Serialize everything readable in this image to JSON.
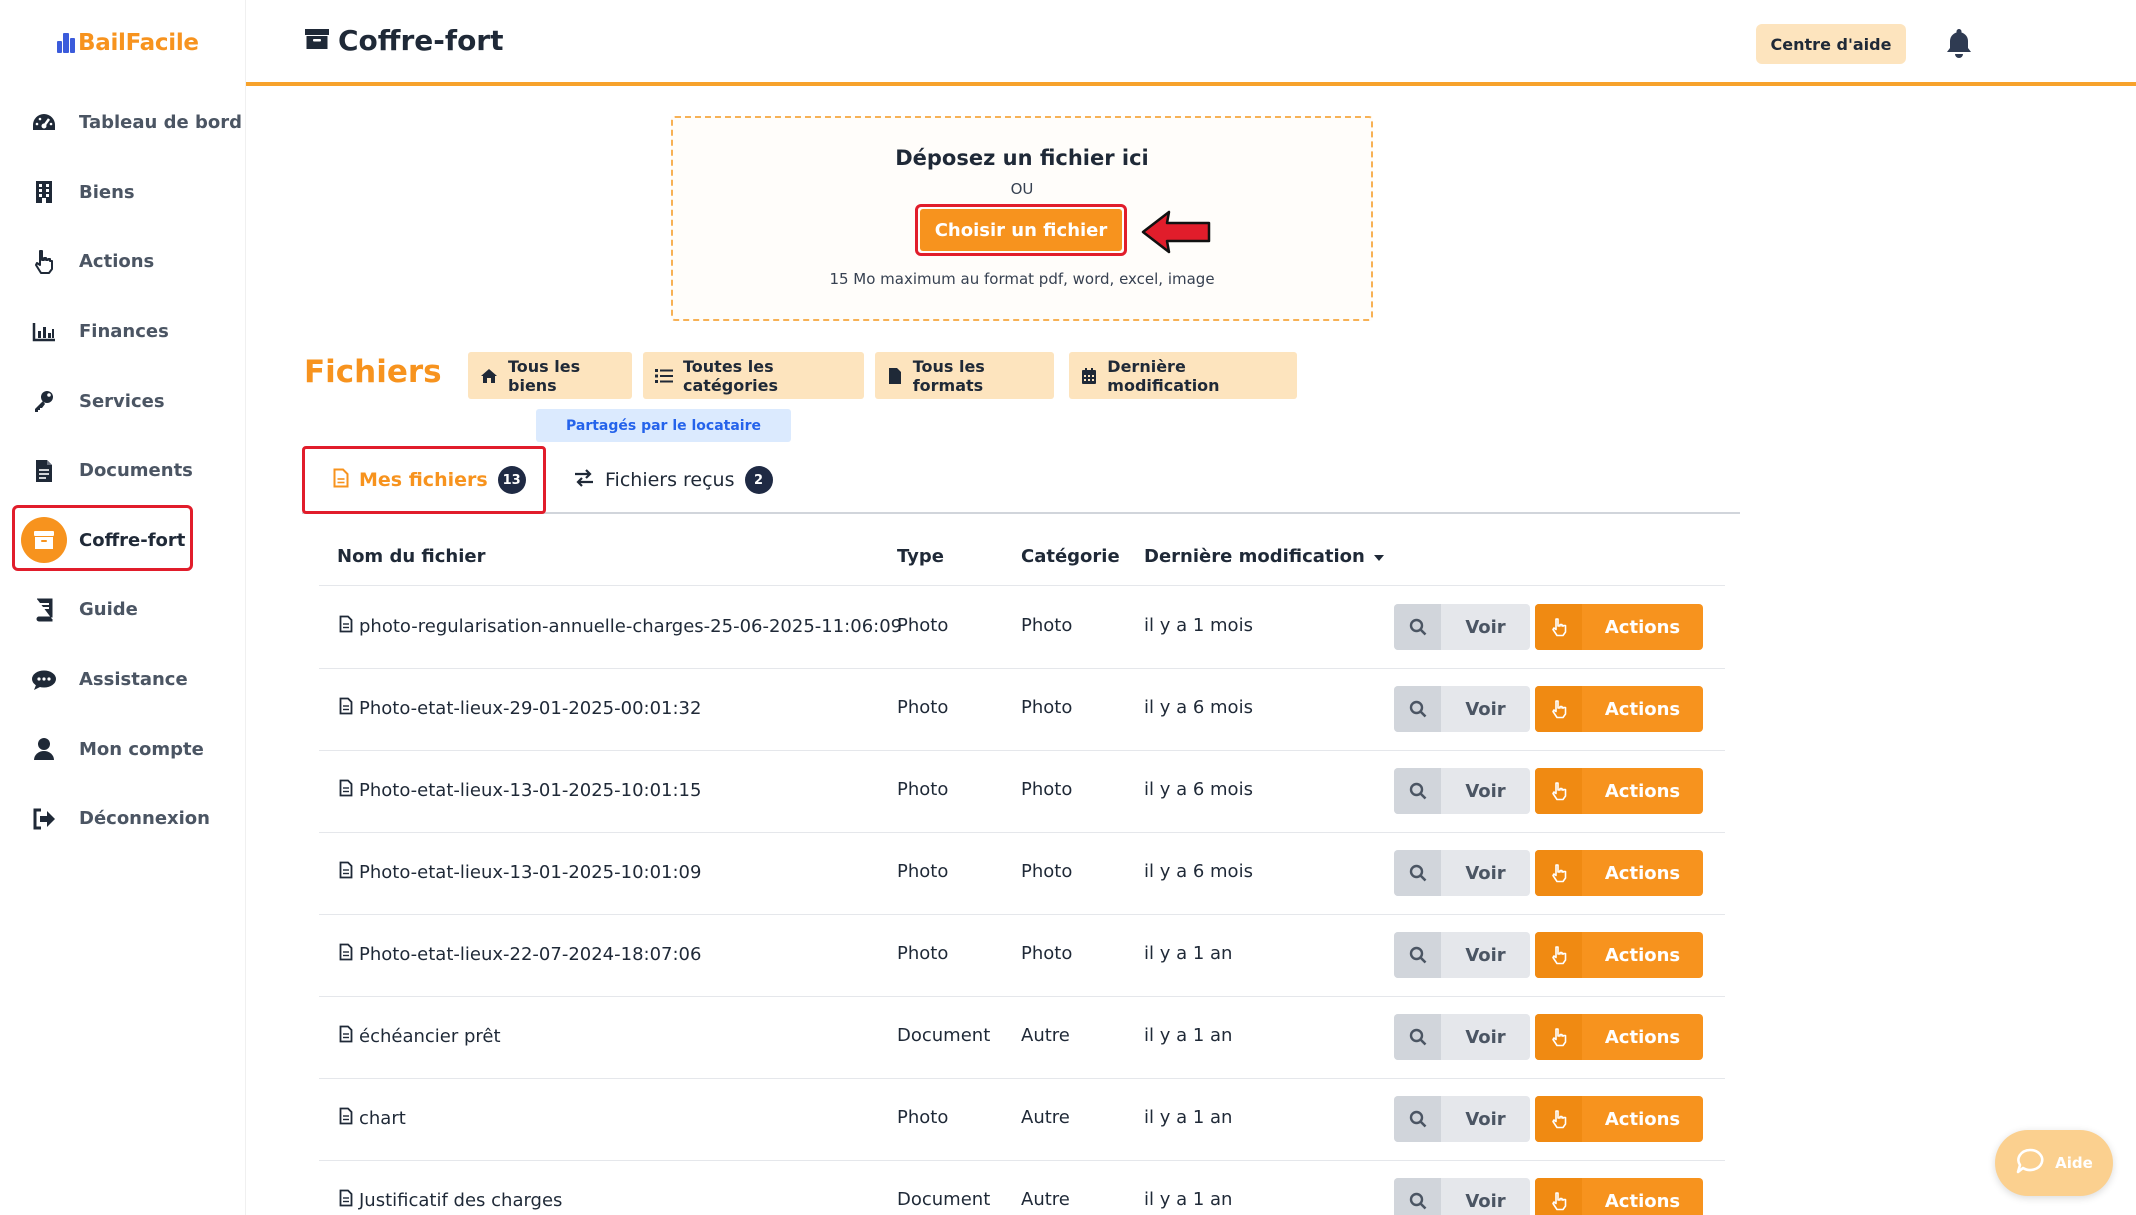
{
  "app": {
    "logo_text": "BailFacile"
  },
  "sidebar": {
    "items": [
      {
        "label": "Tableau de bord",
        "icon": "dashboard-icon"
      },
      {
        "label": "Biens",
        "icon": "building-icon"
      },
      {
        "label": "Actions",
        "icon": "hand-pointer-icon"
      },
      {
        "label": "Finances",
        "icon": "bar-chart-icon"
      },
      {
        "label": "Services",
        "icon": "key-icon"
      },
      {
        "label": "Documents",
        "icon": "file-icon"
      },
      {
        "label": "Coffre-fort",
        "icon": "archive-icon",
        "active": true
      },
      {
        "label": "Guide",
        "icon": "book-icon"
      },
      {
        "label": "Assistance",
        "icon": "chat-icon"
      },
      {
        "label": "Mon compte",
        "icon": "user-icon"
      },
      {
        "label": "Déconnexion",
        "icon": "sign-out-icon"
      }
    ]
  },
  "header": {
    "title": "Coffre-fort",
    "help_label": "Centre d'aide"
  },
  "dropzone": {
    "title": "Déposez un fichier ici",
    "or": "OU",
    "button": "Choisir un fichier",
    "hint": "15 Mo maximum au format pdf, word, excel, image"
  },
  "files": {
    "title": "Fichiers",
    "filters": [
      "Tous les biens",
      "Toutes les catégories",
      "Tous les formats",
      "Dernière modification"
    ],
    "shared_label": "Partagés par le locataire"
  },
  "tabs": {
    "mine": {
      "label": "Mes fichiers",
      "count": "13"
    },
    "received": {
      "label": "Fichiers reçus",
      "count": "2"
    }
  },
  "table": {
    "headers": [
      "Nom du fichier",
      "Type",
      "Catégorie",
      "Dernière modification"
    ],
    "view_label": "Voir",
    "actions_label": "Actions",
    "rows": [
      {
        "name": "photo-regularisation-annuelle-charges-25-06-2025-11:06:09",
        "type": "Photo",
        "category": "Photo",
        "modified": "il y a 1 mois"
      },
      {
        "name": "Photo-etat-lieux-29-01-2025-00:01:32",
        "type": "Photo",
        "category": "Photo",
        "modified": "il y a 6 mois"
      },
      {
        "name": "Photo-etat-lieux-13-01-2025-10:01:15",
        "type": "Photo",
        "category": "Photo",
        "modified": "il y a 6 mois"
      },
      {
        "name": "Photo-etat-lieux-13-01-2025-10:01:09",
        "type": "Photo",
        "category": "Photo",
        "modified": "il y a 6 mois"
      },
      {
        "name": "Photo-etat-lieux-22-07-2024-18:07:06",
        "type": "Photo",
        "category": "Photo",
        "modified": "il y a 1 an"
      },
      {
        "name": "échéancier prêt",
        "type": "Document",
        "category": "Autre",
        "modified": "il y a 1 an"
      },
      {
        "name": "chart",
        "type": "Photo",
        "category": "Autre",
        "modified": "il y a 1 an"
      },
      {
        "name": "Justificatif des charges",
        "type": "Document",
        "category": "Autre",
        "modified": "il y a 1 an"
      }
    ]
  },
  "floating_help": {
    "label": "Aide"
  },
  "colors": {
    "accent": "#f7931e",
    "highlight": "#e11d2b",
    "filter_bg": "#fde4be"
  }
}
